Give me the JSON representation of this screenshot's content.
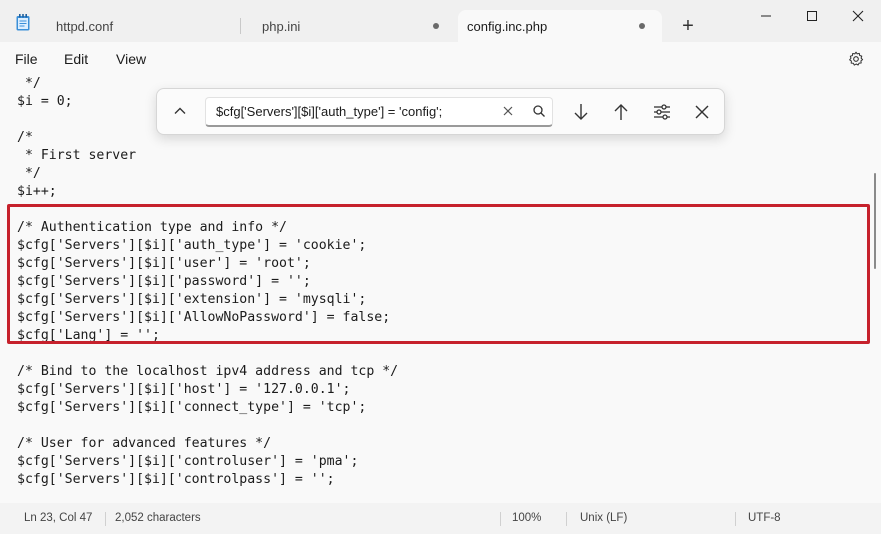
{
  "tabs": [
    {
      "label": "httpd.conf"
    },
    {
      "label": "php.ini"
    },
    {
      "label": "config.inc.php"
    }
  ],
  "menu": {
    "file": "File",
    "edit": "Edit",
    "view": "View"
  },
  "find": {
    "query": "$cfg['Servers'][$i]['auth_type'] = 'config';"
  },
  "code_lines": [
    " */",
    "$i = 0;",
    "",
    "/*",
    " * First server",
    " */",
    "$i++;",
    "",
    "/* Authentication type and info */",
    "$cfg['Servers'][$i]['auth_type'] = 'cookie';",
    "$cfg['Servers'][$i]['user'] = 'root';",
    "$cfg['Servers'][$i]['password'] = '';",
    "$cfg['Servers'][$i]['extension'] = 'mysqli';",
    "$cfg['Servers'][$i]['AllowNoPassword'] = false;",
    "$cfg['Lang'] = '';",
    "",
    "/* Bind to the localhost ipv4 address and tcp */",
    "$cfg['Servers'][$i]['host'] = '127.0.0.1';",
    "$cfg['Servers'][$i]['connect_type'] = 'tcp';",
    "",
    "/* User for advanced features */",
    "$cfg['Servers'][$i]['controluser'] = 'pma';",
    "$cfg['Servers'][$i]['controlpass'] = '';"
  ],
  "status": {
    "position": "Ln 23, Col 47",
    "characters": "2,052 characters",
    "zoom": "100%",
    "line_ending": "Unix (LF)",
    "encoding": "UTF-8"
  },
  "colors": {
    "highlight_border": "#c6212c",
    "editor_bg": "#f9f9f9"
  }
}
